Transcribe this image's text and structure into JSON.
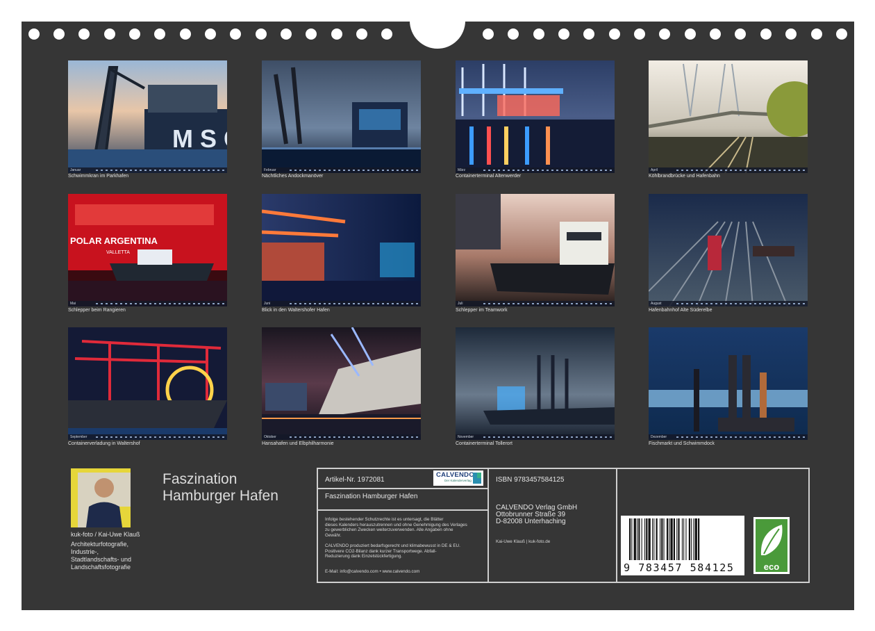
{
  "calendar": {
    "title_line1": "Faszination",
    "title_line2": "Hamburger Hafen",
    "months": [
      {
        "caption": "Schwimmkran im Parkhafen",
        "month_label": "Januar"
      },
      {
        "caption": "Nächtliches Andockmanöver",
        "month_label": "Februar"
      },
      {
        "caption": "Containerterminal Altenwerder",
        "month_label": "März"
      },
      {
        "caption": "Köhlbrandbrücke und Hafenbahn",
        "month_label": "April"
      },
      {
        "caption": "Schlepper beim Rangieren",
        "month_label": "Mai"
      },
      {
        "caption": "Blick in den Waltershofer Hafen",
        "month_label": "Juni"
      },
      {
        "caption": "Schlepper im Teamwork",
        "month_label": "Juli"
      },
      {
        "caption": "Hafenbahnhof Alte Süderelbe",
        "month_label": "August"
      },
      {
        "caption": "Containerverladung in Waltershof",
        "month_label": "September"
      },
      {
        "caption": "Hansahafen und Elbphilharmonie",
        "month_label": "Oktober"
      },
      {
        "caption": "Containerterminal Tollerort",
        "month_label": "November"
      },
      {
        "caption": "Fischmarkt und Schwimmdock",
        "month_label": "Dezember"
      }
    ]
  },
  "artist": {
    "name": "kuk-foto / Kai-Uwe Klauß",
    "description": [
      "Architekturfotografie,",
      "Industrie-,",
      "Stadtlandschafts- und",
      "Landschaftsfotografie"
    ]
  },
  "info": {
    "article_label": "Artikel-Nr. 1972081",
    "product_title": "Faszination Hamburger Hafen",
    "legal_lines": [
      "Infolge bestehender Schutzrechte ist es untersagt, die Blätter",
      "dieses Kalenders herauszutrennen und ohne Genehmigung des Verlages",
      "zu gewerblichen Zwecken weiterzuverwenden. Alle Angaben ohne",
      "Gewähr."
    ],
    "eco_lines": [
      "CALVENDO produziert bedarfsgerecht und klimabewusst in DE & EU.",
      "Positivere CO2-Bilanz dank kurzer Transportwege. Abfall-",
      "Reduzierung dank Einzelstückfertigung."
    ],
    "contact": "E-Mail: info@calvendo.com • www.calvendo.com",
    "publisher_logo": {
      "name": "CALVENDO",
      "tagline": "Der Kalenderverlag"
    },
    "isbn": "ISBN 9783457584125",
    "publisher_lines": [
      "CALVENDO Verlag GmbH",
      "Ottobrunner Straße 39",
      "D-82008 Unterhaching"
    ],
    "credit": "Kai-Uwe Klauß | kuk-foto.de",
    "barcode_digits": "9 783457 584125",
    "eco_badge": "eco"
  },
  "colors": {
    "background": "#363636",
    "text": "#e0e0e0",
    "border": "#cfcfcf",
    "eco_green": "#4a9a3a",
    "brand_blue": "#1f3f7a"
  }
}
